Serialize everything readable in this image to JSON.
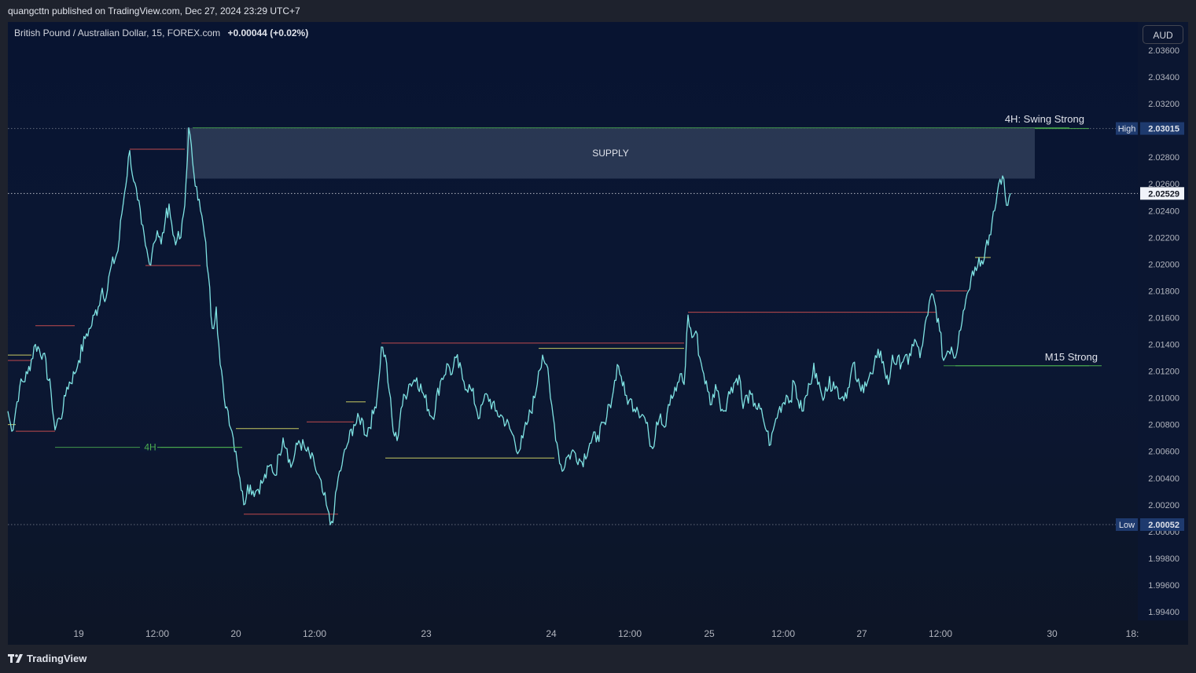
{
  "publisher": {
    "text": "quangcttn published on TradingView.com, Dec 27, 2024 23:29 UTC+7"
  },
  "legend": {
    "symbol": "British Pound / Australian Dollar, 15, FOREX.com",
    "change": "+0.00044 (+0.02%)"
  },
  "currency_button": "AUD",
  "brand": "TradingView",
  "chart_data": {
    "type": "line",
    "symbol": "GBPAUD",
    "timeframe": "15",
    "price_axis": {
      "ylim": [
        1.993,
        2.0373
      ],
      "ticks": [
        "2.03600",
        "2.03400",
        "2.03200",
        "2.02800",
        "2.02600",
        "2.02400",
        "2.02200",
        "2.02000",
        "2.01800",
        "2.01600",
        "2.01400",
        "2.01200",
        "2.01000",
        "2.00800",
        "2.00600",
        "2.00400",
        "2.00200",
        "2.00000",
        "1.99800",
        "1.99600",
        "1.99400"
      ]
    },
    "time_axis": {
      "labels": [
        "19",
        "12:00",
        "20",
        "12:00",
        "23",
        "24",
        "12:00",
        "25",
        "12:00",
        "27",
        "12:00",
        "30",
        "18:"
      ]
    },
    "price_labels": {
      "high": {
        "label": "High",
        "value": "2.03015"
      },
      "current": {
        "value": "2.02529"
      },
      "low": {
        "label": "Low",
        "value": "2.00052"
      }
    },
    "supply_zone": {
      "label": "SUPPLY",
      "price_top": 2.0302,
      "price_bottom": 2.0264
    },
    "annotations": {
      "swing": "4H: Swing Strong",
      "m15": "M15 Strong",
      "h4": "4H"
    },
    "series": [
      {
        "points": [
          [
            0,
            2.009
          ],
          [
            1,
            2.0075
          ],
          [
            3,
            2.0108
          ],
          [
            5,
            2.0118
          ],
          [
            7,
            2.014
          ],
          [
            9,
            2.0133
          ],
          [
            11,
            2.0104
          ],
          [
            12,
            2.0076
          ],
          [
            13,
            2.0085
          ],
          [
            14,
            2.009
          ],
          [
            15,
            2.0108
          ],
          [
            17,
            2.0118
          ],
          [
            18,
            2.0128
          ],
          [
            20,
            2.0148
          ],
          [
            21,
            2.0152
          ],
          [
            22,
            2.0162
          ],
          [
            23,
            2.0168
          ],
          [
            24,
            2.0182
          ],
          [
            25,
            2.0175
          ],
          [
            26,
            2.0195
          ],
          [
            28,
            2.021
          ],
          [
            29,
            2.0238
          ],
          [
            31,
            2.0285
          ],
          [
            32,
            2.0262
          ],
          [
            33,
            2.0248
          ],
          [
            34,
            2.023
          ],
          [
            35,
            2.0214
          ],
          [
            36,
            2.02
          ],
          [
            37,
            2.0215
          ],
          [
            38,
            2.0225
          ],
          [
            39,
            2.0215
          ],
          [
            40,
            2.0232
          ],
          [
            41,
            2.0245
          ],
          [
            42,
            2.0222
          ],
          [
            43,
            2.0218
          ],
          [
            44,
            2.022
          ],
          [
            45,
            2.0244
          ],
          [
            46,
            2.0302
          ],
          [
            47,
            2.0276
          ],
          [
            48,
            2.0258
          ],
          [
            49,
            2.024
          ],
          [
            50,
            2.0222
          ],
          [
            51,
            2.0192
          ],
          [
            52,
            2.0152
          ],
          [
            53,
            2.0168
          ],
          [
            54,
            2.0125
          ],
          [
            55,
            2.01
          ],
          [
            56,
            2.009
          ],
          [
            57,
            2.0075
          ],
          [
            58,
            2.006
          ],
          [
            59,
            2.004
          ],
          [
            60,
            2.002
          ],
          [
            61,
            2.0035
          ],
          [
            63,
            2.003
          ],
          [
            65,
            2.0038
          ],
          [
            67,
            2.005
          ],
          [
            68,
            2.0042
          ],
          [
            69,
            2.0058
          ],
          [
            70,
            2.007
          ],
          [
            71,
            2.0062
          ],
          [
            72,
            2.0048
          ],
          [
            74,
            2.0068
          ],
          [
            76,
            2.006
          ],
          [
            78,
            2.005
          ],
          [
            80,
            2.003
          ],
          [
            81,
            2.002
          ],
          [
            82,
            2.0005
          ],
          [
            83,
            2.0015
          ],
          [
            84,
            2.004
          ],
          [
            85,
            2.005
          ],
          [
            86,
            2.0062
          ],
          [
            88,
            2.008
          ],
          [
            90,
            2.0085
          ],
          [
            91,
            2.0072
          ],
          [
            93,
            2.0088
          ],
          [
            94,
            2.0103
          ],
          [
            95,
            2.0138
          ],
          [
            96,
            2.0132
          ],
          [
            97,
            2.0105
          ],
          [
            98,
            2.0075
          ],
          [
            99,
            2.0068
          ],
          [
            100,
            2.0092
          ],
          [
            102,
            2.011
          ],
          [
            104,
            2.0115
          ],
          [
            106,
            2.01
          ],
          [
            108,
            2.0085
          ],
          [
            110,
            2.0112
          ],
          [
            112,
            2.0125
          ],
          [
            113,
            2.0118
          ],
          [
            114,
            2.013
          ],
          [
            116,
            2.0112
          ],
          [
            118,
            2.0105
          ],
          [
            120,
            2.0085
          ],
          [
            121,
            2.0098
          ],
          [
            122,
            2.0102
          ],
          [
            124,
            2.009
          ],
          [
            126,
            2.0085
          ],
          [
            128,
            2.0075
          ],
          [
            130,
            2.006
          ],
          [
            131,
            2.007
          ],
          [
            132,
            2.008
          ],
          [
            134,
            2.01
          ],
          [
            135,
            2.012
          ],
          [
            136,
            2.0132
          ],
          [
            137,
            2.0125
          ],
          [
            138,
            2.01
          ],
          [
            139,
            2.008
          ],
          [
            140,
            2.006
          ],
          [
            141,
            2.0045
          ],
          [
            142,
            2.0055
          ],
          [
            144,
            2.006
          ],
          [
            146,
            2.0052
          ],
          [
            148,
            2.0066
          ],
          [
            150,
            2.0072
          ],
          [
            152,
            2.008
          ],
          [
            153,
            2.0095
          ],
          [
            154,
            2.0105
          ],
          [
            155,
            2.0125
          ],
          [
            156,
            2.0116
          ],
          [
            157,
            2.0102
          ],
          [
            158,
            2.0098
          ],
          [
            160,
            2.0093
          ],
          [
            162,
            2.0085
          ],
          [
            163,
            2.0072
          ],
          [
            164,
            2.0062
          ],
          [
            165,
            2.0082
          ],
          [
            166,
            2.0088
          ],
          [
            167,
            2.0078
          ],
          [
            168,
            2.0095
          ],
          [
            170,
            2.0105
          ],
          [
            171,
            2.0118
          ],
          [
            172,
            2.011
          ],
          [
            173,
            2.0162
          ],
          [
            174,
            2.0145
          ],
          [
            175,
            2.015
          ],
          [
            176,
            2.013
          ],
          [
            177,
            2.0118
          ],
          [
            178,
            2.0105
          ],
          [
            179,
            2.0095
          ],
          [
            180,
            2.011
          ],
          [
            181,
            2.0098
          ],
          [
            182,
            2.009
          ],
          [
            184,
            2.0108
          ],
          [
            186,
            2.0117
          ],
          [
            187,
            2.0092
          ],
          [
            188,
            2.0102
          ],
          [
            190,
            2.0096
          ],
          [
            192,
            2.0086
          ],
          [
            193,
            2.0075
          ],
          [
            194,
            2.0065
          ],
          [
            195,
            2.008
          ],
          [
            196,
            2.009
          ],
          [
            198,
            2.0102
          ],
          [
            199,
            2.0098
          ],
          [
            200,
            2.0112
          ],
          [
            201,
            2.0098
          ],
          [
            202,
            2.009
          ],
          [
            204,
            2.011
          ],
          [
            205,
            2.0126
          ],
          [
            206,
            2.011
          ],
          [
            207,
            2.0102
          ],
          [
            208,
            2.0108
          ],
          [
            210,
            2.0112
          ],
          [
            212,
            2.01
          ],
          [
            214,
            2.0108
          ],
          [
            215,
            2.0126
          ],
          [
            216,
            2.0112
          ],
          [
            217,
            2.0105
          ],
          [
            218,
            2.0112
          ],
          [
            220,
            2.0118
          ],
          [
            221,
            2.013
          ],
          [
            222,
            2.0135
          ],
          [
            223,
            2.012
          ],
          [
            224,
            2.011
          ],
          [
            225,
            2.0132
          ],
          [
            226,
            2.0125
          ],
          [
            228,
            2.013
          ],
          [
            229,
            2.0125
          ],
          [
            230,
            2.014
          ],
          [
            231,
            2.0142
          ],
          [
            232,
            2.013
          ],
          [
            233,
            2.0148
          ],
          [
            234,
            2.0162
          ],
          [
            235,
            2.0178
          ],
          [
            236,
            2.0168
          ],
          [
            237,
            2.015
          ],
          [
            238,
            2.0128
          ],
          [
            239,
            2.0135
          ],
          [
            240,
            2.0138
          ],
          [
            241,
            2.013
          ],
          [
            242,
            2.015
          ],
          [
            243,
            2.0165
          ],
          [
            244,
            2.0178
          ],
          [
            245,
            2.019
          ],
          [
            246,
            2.0198
          ],
          [
            247,
            2.0205
          ],
          [
            248,
            2.02
          ],
          [
            249,
            2.0218
          ],
          [
            250,
            2.0222
          ],
          [
            251,
            2.024
          ],
          [
            252,
            2.026
          ],
          [
            253,
            2.0266
          ],
          [
            254,
            2.0244
          ],
          [
            255,
            2.0253
          ]
        ]
      }
    ],
    "structure_lines": [
      {
        "color": "yellow",
        "from": [
          0,
          2.0132
        ],
        "to": [
          6,
          2.0132
        ]
      },
      {
        "color": "red",
        "from": [
          0,
          2.0128
        ],
        "to": [
          6,
          2.0128
        ]
      },
      {
        "color": "yellow",
        "from": [
          0,
          2.008
        ],
        "to": [
          2,
          2.008
        ]
      },
      {
        "color": "red",
        "from": [
          2,
          2.0075
        ],
        "to": [
          12,
          2.0075
        ]
      },
      {
        "color": "red",
        "from": [
          7,
          2.0154
        ],
        "to": [
          17,
          2.0154
        ]
      },
      {
        "color": "red",
        "from": [
          31,
          2.0286
        ],
        "to": [
          45,
          2.0286
        ]
      },
      {
        "color": "red",
        "from": [
          35,
          2.0199
        ],
        "to": [
          49,
          2.0199
        ]
      },
      {
        "color": "green",
        "from": [
          12,
          2.0063
        ],
        "to": [
          59,
          2.0063
        ]
      },
      {
        "color": "yellow",
        "from": [
          58,
          2.0077
        ],
        "to": [
          74,
          2.0077
        ]
      },
      {
        "color": "red",
        "from": [
          60,
          2.0013
        ],
        "to": [
          84,
          2.0013
        ]
      },
      {
        "color": "red",
        "from": [
          76,
          2.0082
        ],
        "to": [
          88,
          2.0082
        ]
      },
      {
        "color": "yellow",
        "from": [
          86,
          2.0097
        ],
        "to": [
          91,
          2.0097
        ]
      },
      {
        "color": "red",
        "from": [
          95,
          2.0141
        ],
        "to": [
          172,
          2.0141
        ]
      },
      {
        "color": "yellow",
        "from": [
          135,
          2.0137
        ],
        "to": [
          172,
          2.0137
        ]
      },
      {
        "color": "yellow",
        "from": [
          96,
          2.0055
        ],
        "to": [
          139,
          2.0055
        ]
      },
      {
        "color": "red",
        "from": [
          173,
          2.0164
        ],
        "to": [
          236,
          2.0164
        ]
      },
      {
        "color": "red",
        "from": [
          236,
          2.018
        ],
        "to": [
          244,
          2.018
        ]
      },
      {
        "color": "yellow",
        "from": [
          246,
          2.0205
        ],
        "to": [
          250,
          2.0205
        ]
      },
      {
        "color": "green",
        "from": [
          238,
          2.0124
        ],
        "to": [
          275,
          2.0124
        ]
      },
      {
        "color": "green",
        "from": [
          47,
          2.0302
        ],
        "to": [
          270,
          2.0302
        ]
      }
    ]
  }
}
